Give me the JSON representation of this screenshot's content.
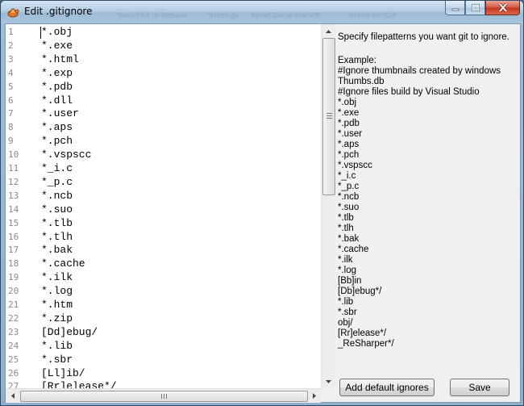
{
  "window": {
    "title": "Edit .gitignore",
    "background_ghost_text": [
      "...",
      "...",
      "Soar/FFX in Rebase",
      "Settings",
      "Reset Local branch",
      "Stash TortGit"
    ]
  },
  "editor": {
    "lines": [
      {
        "num": "1",
        "text": "*.obj"
      },
      {
        "num": "2",
        "text": "*.exe"
      },
      {
        "num": "3",
        "text": "*.html"
      },
      {
        "num": "4",
        "text": "*.exp"
      },
      {
        "num": "5",
        "text": "*.pdb"
      },
      {
        "num": "6",
        "text": "*.dll"
      },
      {
        "num": "7",
        "text": "*.user"
      },
      {
        "num": "8",
        "text": "*.aps"
      },
      {
        "num": "9",
        "text": "*.pch"
      },
      {
        "num": "10",
        "text": "*.vspscc"
      },
      {
        "num": "11",
        "text": "*_i.c"
      },
      {
        "num": "12",
        "text": "*_p.c"
      },
      {
        "num": "13",
        "text": "*.ncb"
      },
      {
        "num": "14",
        "text": "*.suo"
      },
      {
        "num": "15",
        "text": "*.tlb"
      },
      {
        "num": "16",
        "text": "*.tlh"
      },
      {
        "num": "17",
        "text": "*.bak"
      },
      {
        "num": "18",
        "text": "*.cache"
      },
      {
        "num": "19",
        "text": "*.ilk"
      },
      {
        "num": "20",
        "text": "*.log"
      },
      {
        "num": "21",
        "text": "*.htm"
      },
      {
        "num": "22",
        "text": "*.zip"
      },
      {
        "num": "23",
        "text": "[Dd]ebug/"
      },
      {
        "num": "24",
        "text": "*.lib"
      },
      {
        "num": "25",
        "text": "*.sbr"
      },
      {
        "num": "26",
        "text": "[Ll]ib/"
      },
      {
        "num": "27",
        "text": "[Rr]elease*/"
      }
    ]
  },
  "help": {
    "intro": "Specify filepatterns you want git to ignore.",
    "example_lines": [
      "Example:",
      "#Ignore thumbnails created by windows",
      "Thumbs.db",
      "#Ignore files build by Visual Studio",
      "*.obj",
      "*.exe",
      "*.pdb",
      "*.user",
      "*.aps",
      "*.pch",
      "*.vspscc",
      "*_i.c",
      "*_p.c",
      "*.ncb",
      "*.suo",
      "*.tlb",
      "*.tlh",
      "*.bak",
      "*.cache",
      "*.ilk",
      "*.log",
      "[Bb]in",
      "[Db]ebug*/",
      "*.lib",
      "*.sbr",
      "obj/",
      "[Rr]elease*/",
      "_ReSharper*/"
    ]
  },
  "buttons": {
    "add_default": "Add default ignores",
    "save": "Save"
  },
  "icons": {
    "app": "tortoise-icon",
    "minimize": "minimize-icon",
    "maximize": "maximize-icon",
    "close": "close-icon"
  }
}
